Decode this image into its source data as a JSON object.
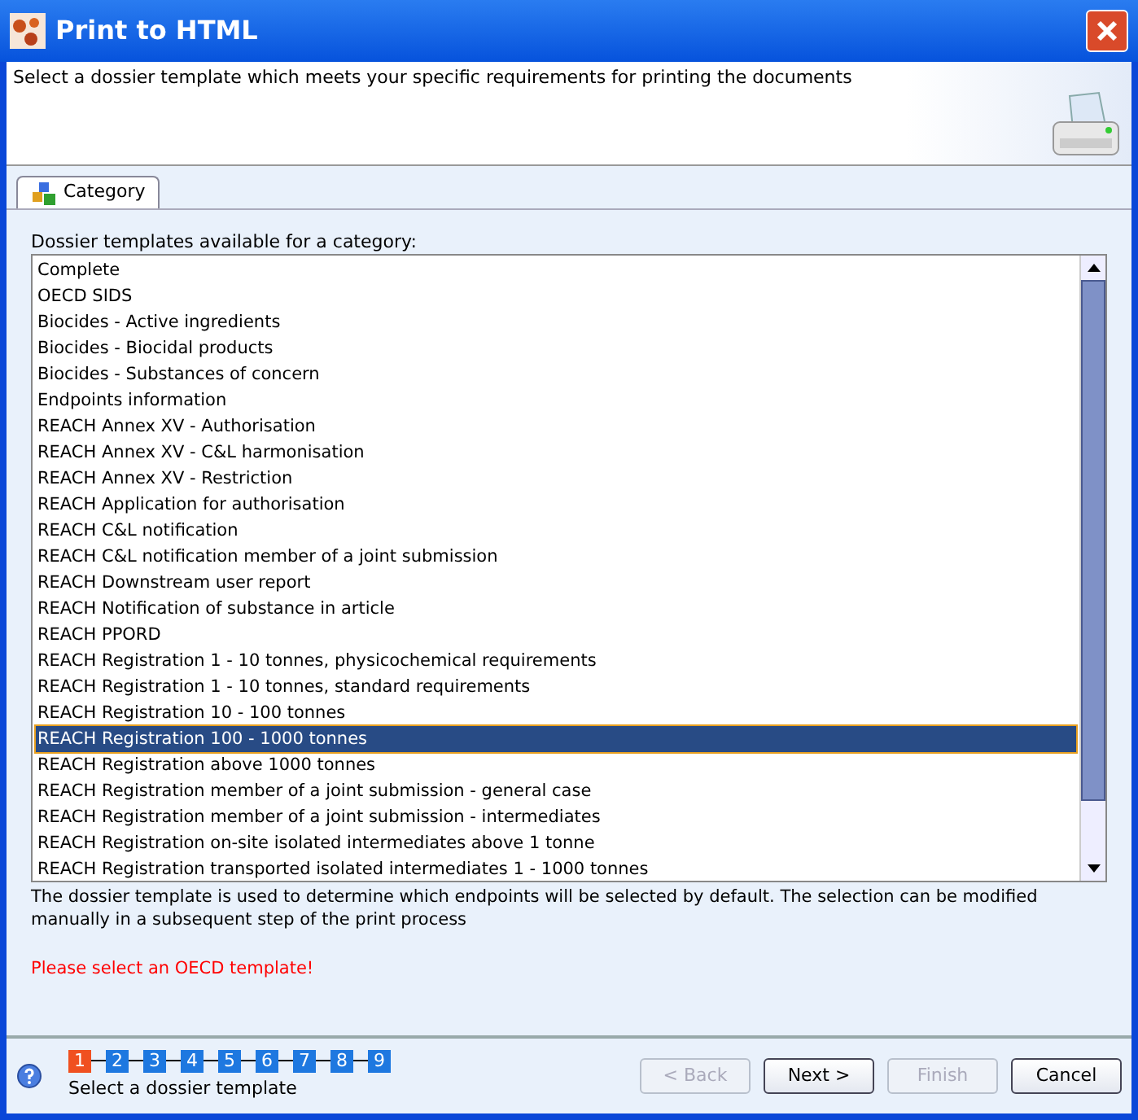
{
  "window": {
    "title": "Print to HTML"
  },
  "header": {
    "text": "Select a dossier template which meets your specific requirements for printing the documents"
  },
  "tabs": [
    {
      "label": "Category",
      "selected": true
    }
  ],
  "list": {
    "label": "Dossier templates available for a category:",
    "items": [
      {
        "label": "Complete",
        "selected": false
      },
      {
        "label": "OECD SIDS",
        "selected": false
      },
      {
        "label": "Biocides - Active ingredients",
        "selected": false
      },
      {
        "label": "Biocides - Biocidal products",
        "selected": false
      },
      {
        "label": "Biocides - Substances of concern",
        "selected": false
      },
      {
        "label": "Endpoints information",
        "selected": false
      },
      {
        "label": "REACH Annex XV - Authorisation",
        "selected": false
      },
      {
        "label": "REACH Annex XV - C&L harmonisation",
        "selected": false
      },
      {
        "label": "REACH Annex XV - Restriction",
        "selected": false
      },
      {
        "label": "REACH Application for authorisation",
        "selected": false
      },
      {
        "label": "REACH C&L notification",
        "selected": false
      },
      {
        "label": "REACH C&L notification member of a joint submission",
        "selected": false
      },
      {
        "label": "REACH Downstream user report",
        "selected": false
      },
      {
        "label": "REACH Notification of substance in article",
        "selected": false
      },
      {
        "label": "REACH PPORD",
        "selected": false
      },
      {
        "label": "REACH Registration 1 - 10 tonnes, physicochemical requirements",
        "selected": false
      },
      {
        "label": "REACH Registration 1 - 10 tonnes, standard requirements",
        "selected": false
      },
      {
        "label": "REACH Registration 10 - 100 tonnes",
        "selected": false
      },
      {
        "label": "REACH Registration 100 - 1000 tonnes",
        "selected": true
      },
      {
        "label": "REACH Registration above 1000 tonnes",
        "selected": false
      },
      {
        "label": "REACH Registration member of a joint submission - general case",
        "selected": false
      },
      {
        "label": "REACH Registration member of a joint submission - intermediates",
        "selected": false
      },
      {
        "label": "REACH Registration on-site isolated intermediates above 1 tonne",
        "selected": false
      },
      {
        "label": "REACH Registration transported isolated intermediates 1 - 1000 tonnes",
        "selected": false
      }
    ]
  },
  "description": "The dossier template is used to determine which endpoints will be selected by default. The selection can be modified manually in a subsequent step of the print process",
  "error": "Please select an OECD template!",
  "steps": [
    {
      "label": "1",
      "selected": true
    },
    {
      "label": "2",
      "selected": false
    },
    {
      "label": "3",
      "selected": false
    },
    {
      "label": "4",
      "selected": false
    },
    {
      "label": "5",
      "selected": false
    },
    {
      "label": "6",
      "selected": false
    },
    {
      "label": "7",
      "selected": false
    },
    {
      "label": "8",
      "selected": false
    },
    {
      "label": "9",
      "selected": false
    }
  ],
  "step_caption": "Select a dossier template",
  "buttons": [
    {
      "label": "< Back",
      "disabled": true
    },
    {
      "label": "Next >",
      "disabled": false
    },
    {
      "label": "Finish",
      "disabled": true
    },
    {
      "label": "Cancel",
      "disabled": false
    }
  ]
}
